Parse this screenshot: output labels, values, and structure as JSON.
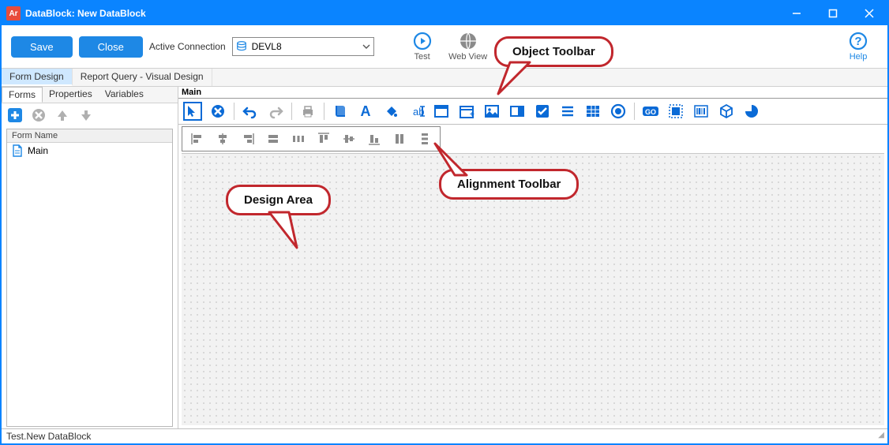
{
  "title": "DataBlock: New DataBlock",
  "app_icon_text": "Ar",
  "toolbar": {
    "save_label": "Save",
    "close_label": "Close",
    "connection_label": "Active Connection",
    "connection_value": "DEVL8",
    "test_label": "Test",
    "webview_label": "Web View",
    "help_label": "Help"
  },
  "main_tabs": {
    "form_design": "Form Design",
    "report_query": "Report Query - Visual Design"
  },
  "sub_tabs": {
    "forms": "Forms",
    "properties": "Properties",
    "variables": "Variables"
  },
  "form_panel": {
    "header": "Form Name",
    "item": "Main"
  },
  "main_header": "Main",
  "callouts": {
    "object_toolbar": "Object Toolbar",
    "alignment_toolbar": "Alignment Toolbar",
    "design_area": "Design Area"
  },
  "status": "Test.New DataBlock"
}
